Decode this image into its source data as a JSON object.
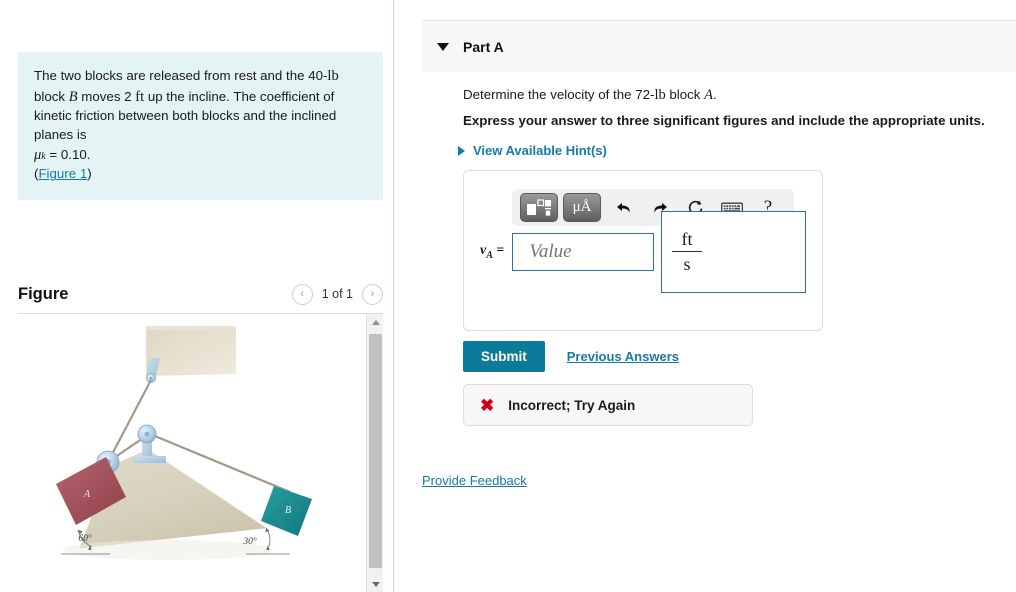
{
  "problem": {
    "text_part1": "The two blocks are released from rest and the 40-",
    "unit_lb": "lb",
    "text_part2": " block ",
    "block_b": "B",
    "text_part3": " moves 2 ",
    "unit_ft": "ft",
    "text_part4": " up the incline. The coefficient of kinetic friction between both blocks and the inclined planes is ",
    "mu_symbol": "μ",
    "mu_sub": "k",
    "mu_value": " = 0.10.",
    "figure_link": "Figure 1",
    "paren_open": "(",
    "paren_close": ")"
  },
  "figure_panel": {
    "title": "Figure",
    "count_label": "1 of 1",
    "prev_icon": "chevron-left-icon",
    "next_icon": "chevron-right-icon",
    "prev_glyph": "‹",
    "next_glyph": "›",
    "diagram": {
      "block_a_label": "A",
      "block_b_label": "B",
      "angle_a": "60°",
      "angle_b": "30°",
      "block_a_color": "#a6525c",
      "block_b_color": "#1a8b92",
      "incline_color": "#d6cfbd",
      "pulley_color": "#a8c8e0",
      "cord_color": "#a09b86"
    },
    "scrollbar": {
      "up_icon": "scroll-up-arrow-icon",
      "down_icon": "scroll-down-arrow-icon"
    }
  },
  "part": {
    "title": "Part A",
    "toggle_icon": "chevron-down-icon",
    "prompt_prefix": "Determine the velocity of the 72-",
    "prompt_unit": "lb",
    "prompt_mid": " block ",
    "prompt_block": "A",
    "prompt_suffix": ".",
    "instruction": "Express your answer to three significant figures and include the appropriate units.",
    "hints_label": "View Available Hint(s)",
    "hints_icon": "chevron-right-icon"
  },
  "answer": {
    "variable": "v",
    "variable_sub": "A",
    "equals": "=",
    "value_placeholder": "Value",
    "value_current": "",
    "units_numerator": "ft",
    "units_denominator": "s",
    "toolbar": {
      "template_icon": "math-template-icon",
      "units_icon": "micro-angstrom-units-icon",
      "units_label": "μÅ",
      "undo_icon": "undo-arrow-icon",
      "undo_glyph": "↶",
      "redo_icon": "redo-arrow-icon",
      "redo_glyph": "↷",
      "reset_icon": "reset-circle-icon",
      "reset_glyph": "↻",
      "keyboard_icon": "keyboard-icon",
      "help_icon": "help-question-icon",
      "help_glyph": "?"
    }
  },
  "actions": {
    "submit_label": "Submit",
    "previous_answers_label": "Previous Answers",
    "submit_color": "#0c7b9b"
  },
  "feedback": {
    "icon": "incorrect-x-icon",
    "glyph": "✖",
    "message": "Incorrect; Try Again",
    "color": "#d0021b"
  },
  "footer": {
    "provide_feedback_label": "Provide Feedback"
  }
}
